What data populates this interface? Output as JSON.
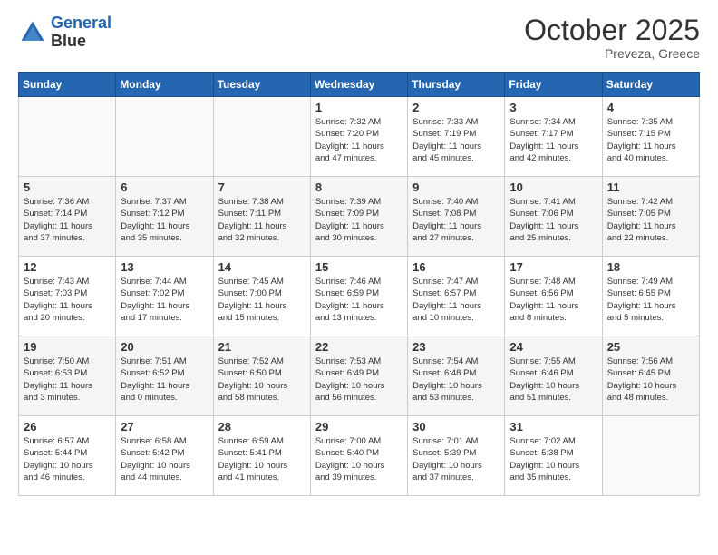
{
  "header": {
    "logo_line1": "General",
    "logo_line2": "Blue",
    "month": "October 2025",
    "location": "Preveza, Greece"
  },
  "days_of_week": [
    "Sunday",
    "Monday",
    "Tuesday",
    "Wednesday",
    "Thursday",
    "Friday",
    "Saturday"
  ],
  "weeks": [
    [
      {
        "day": "",
        "info": ""
      },
      {
        "day": "",
        "info": ""
      },
      {
        "day": "",
        "info": ""
      },
      {
        "day": "1",
        "info": "Sunrise: 7:32 AM\nSunset: 7:20 PM\nDaylight: 11 hours\nand 47 minutes."
      },
      {
        "day": "2",
        "info": "Sunrise: 7:33 AM\nSunset: 7:19 PM\nDaylight: 11 hours\nand 45 minutes."
      },
      {
        "day": "3",
        "info": "Sunrise: 7:34 AM\nSunset: 7:17 PM\nDaylight: 11 hours\nand 42 minutes."
      },
      {
        "day": "4",
        "info": "Sunrise: 7:35 AM\nSunset: 7:15 PM\nDaylight: 11 hours\nand 40 minutes."
      }
    ],
    [
      {
        "day": "5",
        "info": "Sunrise: 7:36 AM\nSunset: 7:14 PM\nDaylight: 11 hours\nand 37 minutes."
      },
      {
        "day": "6",
        "info": "Sunrise: 7:37 AM\nSunset: 7:12 PM\nDaylight: 11 hours\nand 35 minutes."
      },
      {
        "day": "7",
        "info": "Sunrise: 7:38 AM\nSunset: 7:11 PM\nDaylight: 11 hours\nand 32 minutes."
      },
      {
        "day": "8",
        "info": "Sunrise: 7:39 AM\nSunset: 7:09 PM\nDaylight: 11 hours\nand 30 minutes."
      },
      {
        "day": "9",
        "info": "Sunrise: 7:40 AM\nSunset: 7:08 PM\nDaylight: 11 hours\nand 27 minutes."
      },
      {
        "day": "10",
        "info": "Sunrise: 7:41 AM\nSunset: 7:06 PM\nDaylight: 11 hours\nand 25 minutes."
      },
      {
        "day": "11",
        "info": "Sunrise: 7:42 AM\nSunset: 7:05 PM\nDaylight: 11 hours\nand 22 minutes."
      }
    ],
    [
      {
        "day": "12",
        "info": "Sunrise: 7:43 AM\nSunset: 7:03 PM\nDaylight: 11 hours\nand 20 minutes."
      },
      {
        "day": "13",
        "info": "Sunrise: 7:44 AM\nSunset: 7:02 PM\nDaylight: 11 hours\nand 17 minutes."
      },
      {
        "day": "14",
        "info": "Sunrise: 7:45 AM\nSunset: 7:00 PM\nDaylight: 11 hours\nand 15 minutes."
      },
      {
        "day": "15",
        "info": "Sunrise: 7:46 AM\nSunset: 6:59 PM\nDaylight: 11 hours\nand 13 minutes."
      },
      {
        "day": "16",
        "info": "Sunrise: 7:47 AM\nSunset: 6:57 PM\nDaylight: 11 hours\nand 10 minutes."
      },
      {
        "day": "17",
        "info": "Sunrise: 7:48 AM\nSunset: 6:56 PM\nDaylight: 11 hours\nand 8 minutes."
      },
      {
        "day": "18",
        "info": "Sunrise: 7:49 AM\nSunset: 6:55 PM\nDaylight: 11 hours\nand 5 minutes."
      }
    ],
    [
      {
        "day": "19",
        "info": "Sunrise: 7:50 AM\nSunset: 6:53 PM\nDaylight: 11 hours\nand 3 minutes."
      },
      {
        "day": "20",
        "info": "Sunrise: 7:51 AM\nSunset: 6:52 PM\nDaylight: 11 hours\nand 0 minutes."
      },
      {
        "day": "21",
        "info": "Sunrise: 7:52 AM\nSunset: 6:50 PM\nDaylight: 10 hours\nand 58 minutes."
      },
      {
        "day": "22",
        "info": "Sunrise: 7:53 AM\nSunset: 6:49 PM\nDaylight: 10 hours\nand 56 minutes."
      },
      {
        "day": "23",
        "info": "Sunrise: 7:54 AM\nSunset: 6:48 PM\nDaylight: 10 hours\nand 53 minutes."
      },
      {
        "day": "24",
        "info": "Sunrise: 7:55 AM\nSunset: 6:46 PM\nDaylight: 10 hours\nand 51 minutes."
      },
      {
        "day": "25",
        "info": "Sunrise: 7:56 AM\nSunset: 6:45 PM\nDaylight: 10 hours\nand 48 minutes."
      }
    ],
    [
      {
        "day": "26",
        "info": "Sunrise: 6:57 AM\nSunset: 5:44 PM\nDaylight: 10 hours\nand 46 minutes."
      },
      {
        "day": "27",
        "info": "Sunrise: 6:58 AM\nSunset: 5:42 PM\nDaylight: 10 hours\nand 44 minutes."
      },
      {
        "day": "28",
        "info": "Sunrise: 6:59 AM\nSunset: 5:41 PM\nDaylight: 10 hours\nand 41 minutes."
      },
      {
        "day": "29",
        "info": "Sunrise: 7:00 AM\nSunset: 5:40 PM\nDaylight: 10 hours\nand 39 minutes."
      },
      {
        "day": "30",
        "info": "Sunrise: 7:01 AM\nSunset: 5:39 PM\nDaylight: 10 hours\nand 37 minutes."
      },
      {
        "day": "31",
        "info": "Sunrise: 7:02 AM\nSunset: 5:38 PM\nDaylight: 10 hours\nand 35 minutes."
      },
      {
        "day": "",
        "info": ""
      }
    ]
  ]
}
